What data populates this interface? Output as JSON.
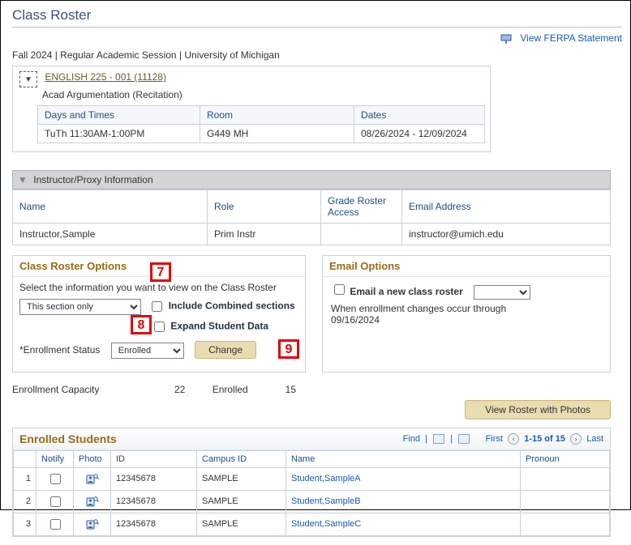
{
  "page": {
    "title": "Class Roster"
  },
  "ferpa": {
    "link": "View FERPA Statement"
  },
  "session": {
    "term": "Fall 2024",
    "type": "Regular Academic Session",
    "org": "University of Michigan"
  },
  "class": {
    "link": "ENGLISH 225 - 001 (11128)",
    "desc": "Acad Argumentation (Recitation)",
    "cols": {
      "days": "Days and Times",
      "room": "Room",
      "dates": "Dates"
    },
    "row": {
      "days": "TuTh 11:30AM-1:00PM",
      "room": "G449 MH",
      "dates": "08/26/2024 - 12/09/2024"
    }
  },
  "instructor_section": {
    "title": "Instructor/Proxy Information",
    "cols": {
      "name": "Name",
      "role": "Role",
      "access": "Grade Roster Access",
      "email": "Email Address"
    },
    "row": {
      "name": "Instructor,Sample",
      "role": "Prim Instr",
      "access": "",
      "email": "instructor@umich.edu"
    }
  },
  "roster_options": {
    "title": "Class Roster Options",
    "blurb": "Select the information you want to view on the Class Roster",
    "section_select": "This section only",
    "include_combined": "Include Combined sections",
    "expand_data": "Expand Student Data",
    "enroll_label": "*Enrollment Status",
    "enroll_value": "Enrolled",
    "change_btn": "Change"
  },
  "email_options": {
    "title": "Email Options",
    "chk": "Email a new class roster",
    "line1": "When enrollment changes occur through",
    "line2": "09/16/2024"
  },
  "capacity": {
    "cap_label": "Enrollment Capacity",
    "cap_value": "22",
    "enr_label": "Enrolled",
    "enr_value": "15"
  },
  "view_photos_btn": "View Roster with Photos",
  "enrolled": {
    "title": "Enrolled Students",
    "find": "Find",
    "first": "First",
    "range": "1-15 of 15",
    "last": "Last",
    "cols": {
      "notify": "Notify",
      "photo": "Photo",
      "id": "ID",
      "campus": "Campus ID",
      "name": "Name",
      "pronoun": "Pronoun"
    },
    "rows": [
      {
        "n": "1",
        "id": "12345678",
        "campus": "SAMPLE",
        "name": "Student,SampleA"
      },
      {
        "n": "2",
        "id": "12345678",
        "campus": "SAMPLE",
        "name": "Student,SampleB"
      },
      {
        "n": "3",
        "id": "12345678",
        "campus": "SAMPLE",
        "name": "Student,SampleC"
      }
    ]
  },
  "callouts": {
    "c7": "7",
    "c8": "8",
    "c9": "9"
  }
}
